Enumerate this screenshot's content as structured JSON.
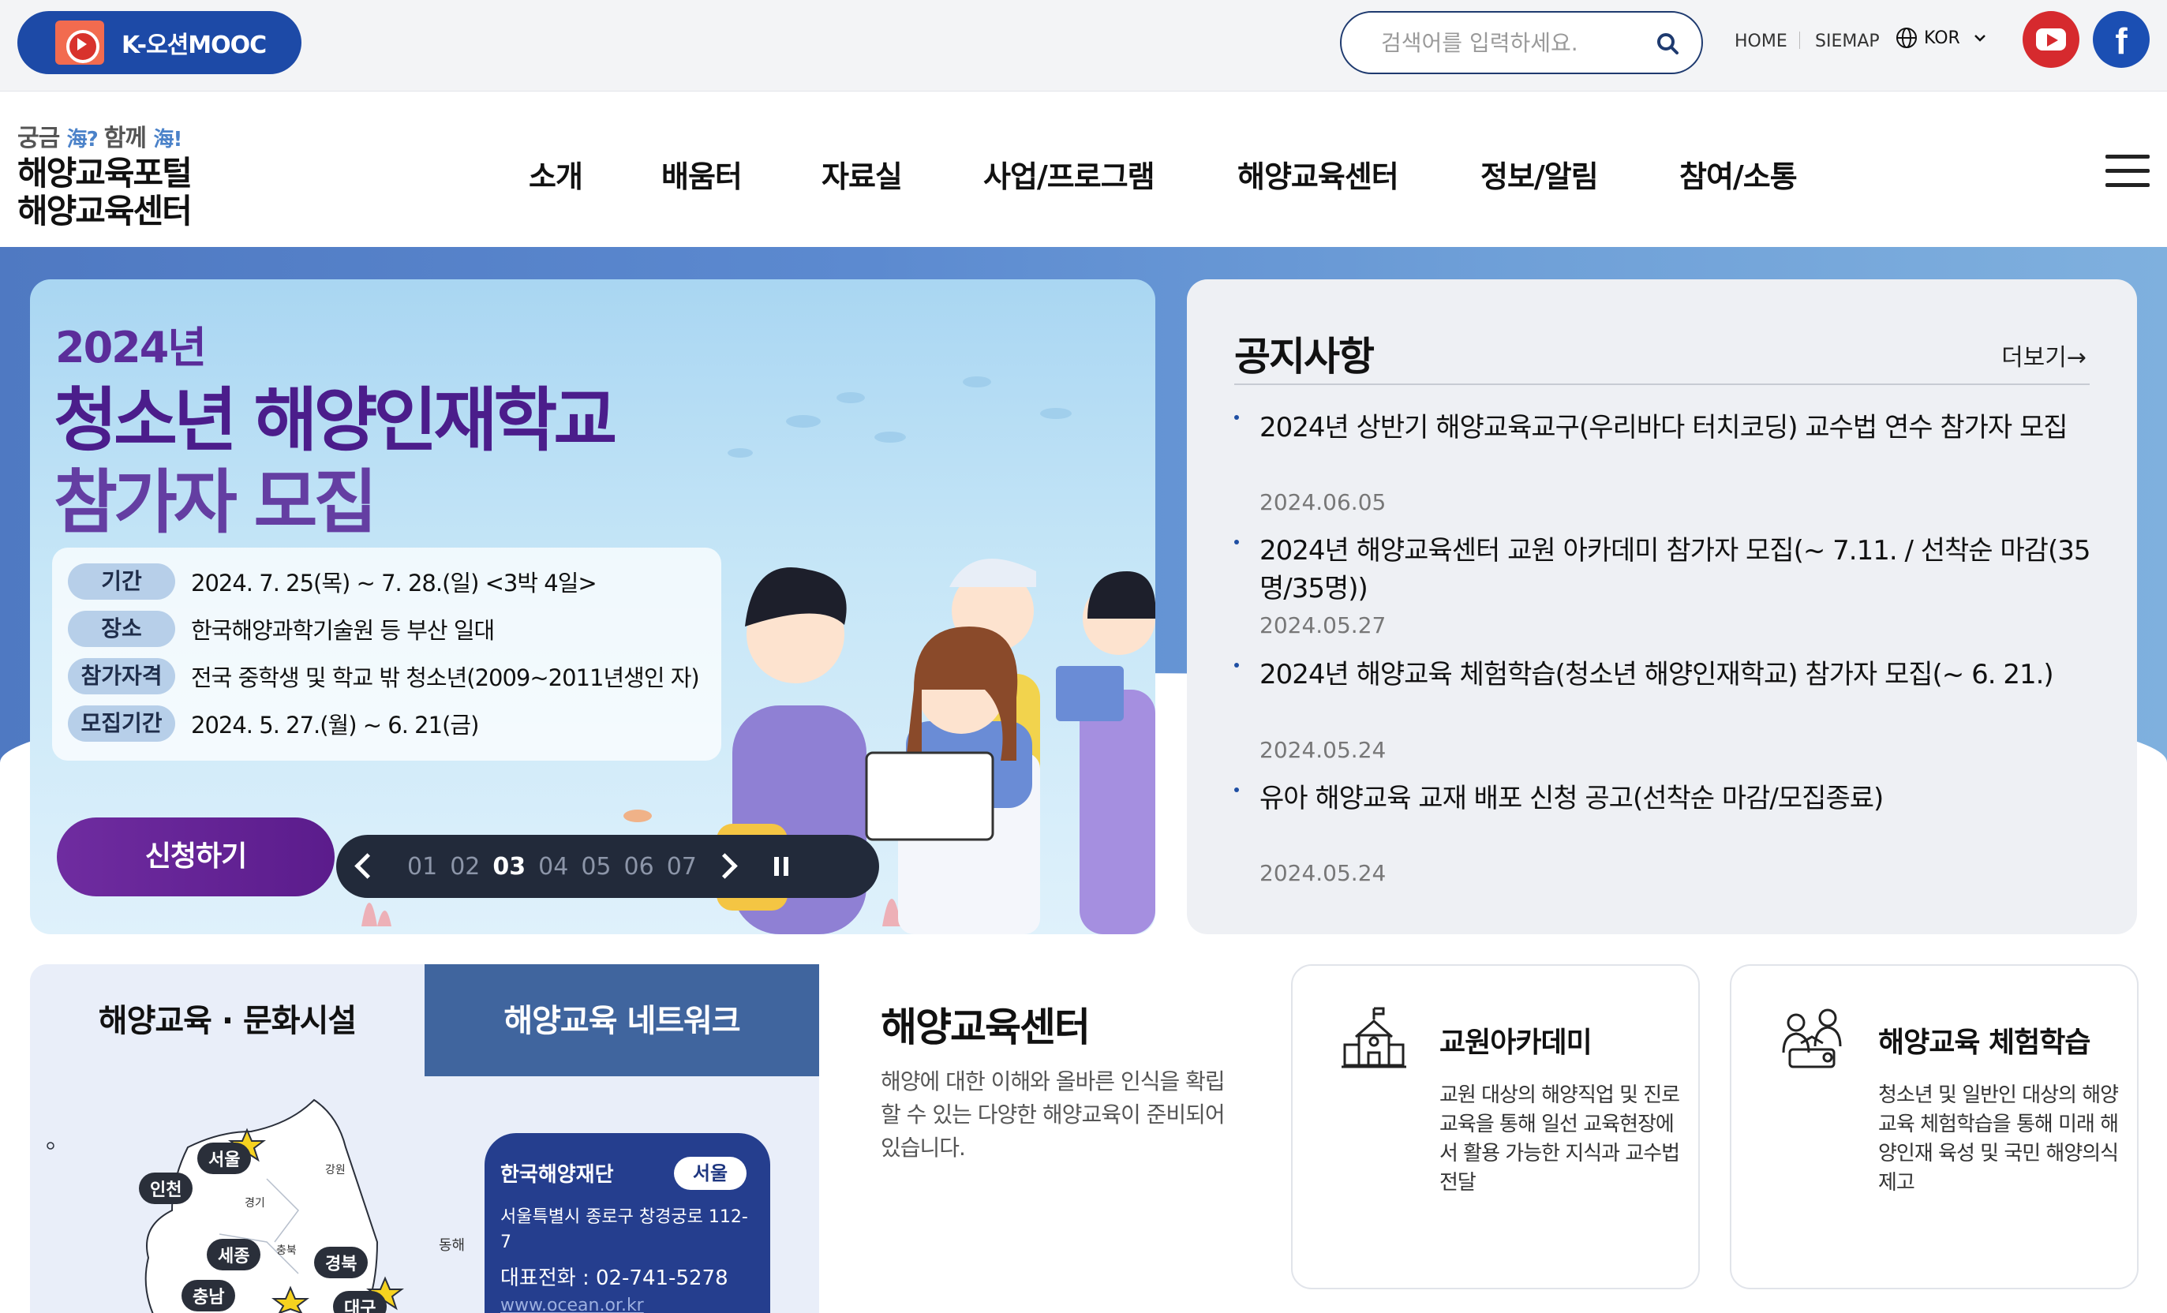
{
  "topbar": {
    "kmooc_label": "K-오션MOOC",
    "search_placeholder": "검색어를 입력하세요.",
    "home": "HOME",
    "sitemap": "SIEMAP",
    "lang": "KOR"
  },
  "brand": {
    "sub_a": "궁금 ",
    "sub_b": "海? ",
    "sub_c": "함께 ",
    "sub_d": "海!",
    "line1": "해양교육포털",
    "line2": "해양교육센터"
  },
  "nav": {
    "items": [
      "소개",
      "배움터",
      "자료실",
      "사업/프로그램",
      "해양교육센터",
      "정보/알림",
      "참여/소통"
    ]
  },
  "banner": {
    "year": "2024년",
    "title1": "청소년 해양인재학교",
    "title2": "참가자 모집",
    "rows": [
      {
        "label": "기간",
        "value": "2024. 7. 25(목) ~ 7. 28.(일) <3박 4일>"
      },
      {
        "label": "장소",
        "value": "한국해양과학기술원 등 부산 일대"
      },
      {
        "label": "참가자격",
        "value": "전국 중학생 및 학교 밖 청소년(2009~2011년생인 자)"
      },
      {
        "label": "모집기간",
        "value": "2024. 5. 27.(월) ~ 6. 21(금)"
      }
    ],
    "apply": "신청하기",
    "pages": [
      "01",
      "02",
      "03",
      "04",
      "05",
      "06",
      "07"
    ],
    "current_page": "03"
  },
  "notice": {
    "title": "공지사항",
    "more": "더보기→",
    "items": [
      {
        "title": "2024년 상반기 해양교육교구(우리바다 터치코딩) 교수법 연수 참가자 모집",
        "date": "2024.06.05"
      },
      {
        "title": "2024년 해양교육센터 교원 아카데미 참가자 모집(~ 7.11. / 선착순 마감(35명/35명))",
        "date": "2024.05.27"
      },
      {
        "title": "2024년 해양교육 체험학습(청소년 해양인재학교) 참가자 모집(~ 6. 21.)",
        "date": "2024.05.24"
      },
      {
        "title": "유아 해양교육 교재 배포 신청 공고(선착순 마감/모집종료)",
        "date": "2024.05.24"
      }
    ]
  },
  "facility": {
    "tab1": "해양교육 · 문화시설",
    "tab2": "해양교육 네트워크",
    "cities": [
      "서울",
      "인천",
      "세종",
      "경북",
      "충남",
      "대구"
    ],
    "regions": [
      "강원",
      "경기",
      "충북",
      "동해"
    ],
    "org": {
      "name": "한국해양재단",
      "badge": "서울",
      "addr": "서울특별시 종로구 창경궁로 112-7",
      "tel": "대표전화 : 02-741-5278",
      "web": "www.ocean.or.kr"
    }
  },
  "center": {
    "title": "해양교육센터",
    "desc": "해양에 대한 이해와 올바른 인식을 확립할 수 있는 다양한 해양교육이 준비되어 있습니다."
  },
  "programs": [
    {
      "title": "교원아카데미",
      "desc": "교원 대상의 해양직업 및 진로교육을 통해 일선 교육현장에서 활용 가능한 지식과 교수법 전달",
      "icon": "school-icon"
    },
    {
      "title": "해양교육 체험학습",
      "desc": "청소년 및 일반인 대상의 해양교육 체험학습을 통해 미래 해양인재 육성 및 국민 해양의식 제고",
      "icon": "people-icon"
    }
  ],
  "colors": {
    "brand_blue": "#1d4aa7",
    "apply_purple": "#6f2ca0",
    "network_blue": "#40659e",
    "youtube_red": "#d62a2e"
  }
}
